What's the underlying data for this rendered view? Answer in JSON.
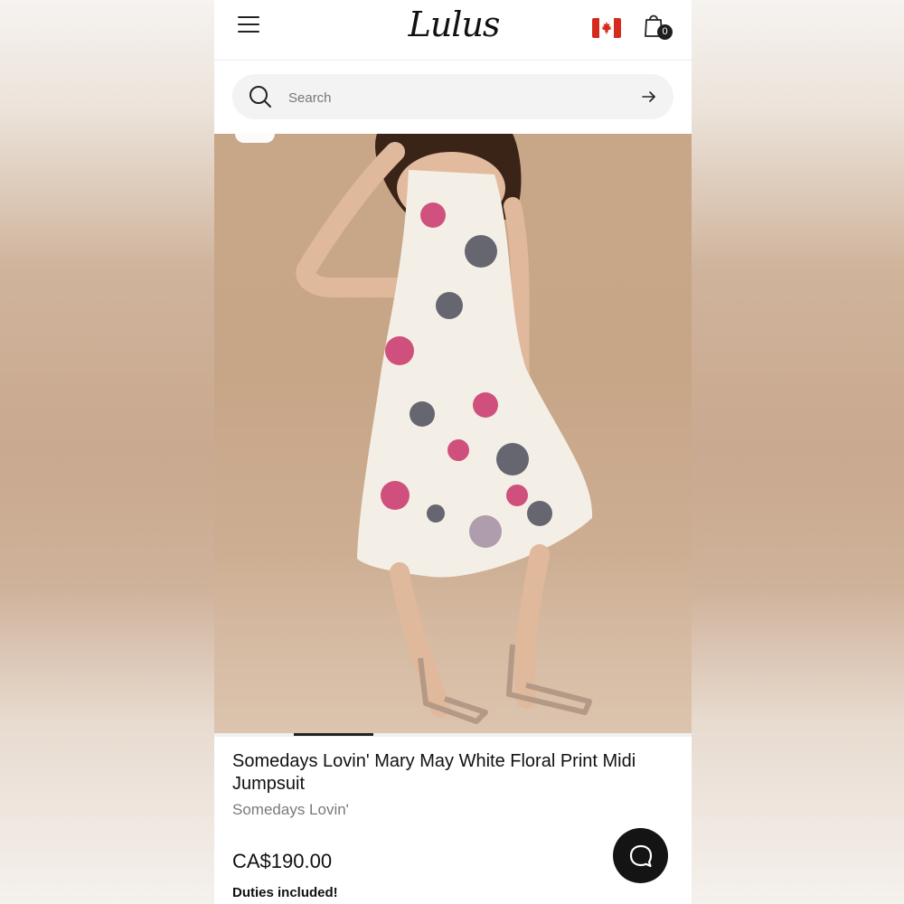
{
  "header": {
    "logo_text": "Lulus",
    "cart_count": "0"
  },
  "search": {
    "placeholder": "Search"
  },
  "carousel": {
    "active_index": 1,
    "total": 6
  },
  "product": {
    "title": "Somedays Lovin' Mary May White Floral Print Midi Jumpsuit",
    "brand": "Somedays Lovin'",
    "price": "CA$190.00",
    "duties_note": "Duties included!"
  },
  "colors": {
    "accent": "#141414",
    "flag_red": "#d52b1e",
    "background_tan": "#c8a688"
  }
}
